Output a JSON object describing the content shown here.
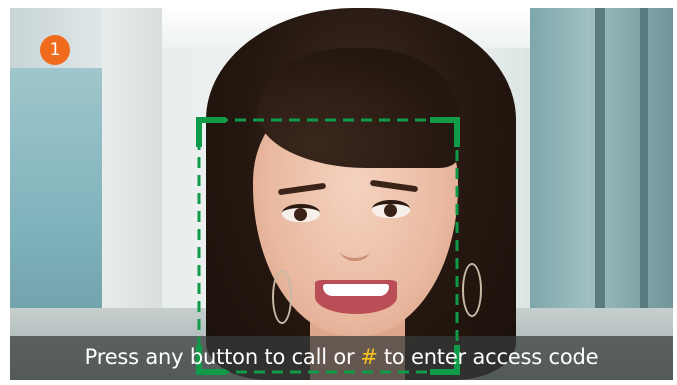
{
  "step_badge": {
    "number": "1",
    "color": "#f06b1c"
  },
  "prompt": {
    "before": "Press any button to call or",
    "key": "#",
    "after": "to enter access code",
    "key_color": "#f3c11a"
  },
  "face_frame": {
    "color": "#0f9b47",
    "style": "dashed-with-solid-corners"
  },
  "icons": [
    "face-detection-frame-icon"
  ]
}
